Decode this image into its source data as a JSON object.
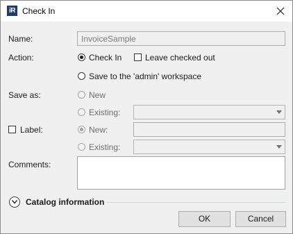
{
  "window": {
    "title": "Check In",
    "app_icon_text": "iR"
  },
  "form": {
    "name_label": "Name:",
    "name_value": "InvoiceSample",
    "action_label": "Action:",
    "action_checkin": "Check In",
    "leave_checked_out": "Leave checked out",
    "action_save_workspace": "Save to the 'admin' workspace",
    "save_as_label": "Save as:",
    "save_as_new": "New",
    "save_as_existing": "Existing:",
    "label_checkbox": "Label:",
    "label_new": "New:",
    "label_existing": "Existing:",
    "comments_label": "Comments:",
    "comments_value": ""
  },
  "catalog": {
    "title": "Catalog information"
  },
  "buttons": {
    "ok": "OK",
    "cancel": "Cancel"
  },
  "colors": {
    "accent_line": "#c8d8ee",
    "window_bg": "#f0f0f0"
  }
}
